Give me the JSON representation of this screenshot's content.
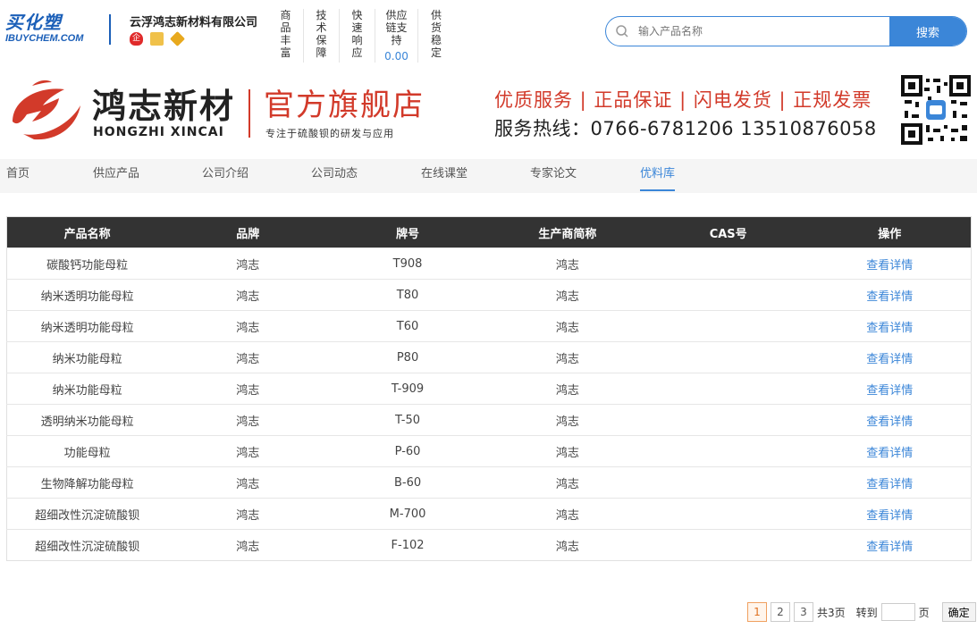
{
  "site": {
    "logo_cn": "买化塑",
    "logo_en": "IBUYCHEM.COM",
    "company": "云浮鸿志新材料有限公司",
    "features": [
      {
        "label": "商品丰富"
      },
      {
        "label": "技术保障"
      },
      {
        "label": "快速响应"
      },
      {
        "label": "供应链支持",
        "value": "0.00"
      },
      {
        "label": "供货稳定"
      }
    ],
    "search": {
      "placeholder": "输入产品名称",
      "button": "搜索"
    }
  },
  "banner": {
    "brand_cn": "鸿志新材",
    "brand_en": "HONGZHI XINCAI",
    "flagship": "官方旗舰店",
    "flagship_sub": "专注于硫酸钡的研发与应用",
    "slogan": "优质服务 | 正品保证 | 闪电发货 | 正规发票",
    "hotline": "服务热线：0766-6781206  13510876058"
  },
  "nav": {
    "items": [
      "首页",
      "供应产品",
      "公司介绍",
      "公司动态",
      "在线课堂",
      "专家论文",
      "优料库"
    ],
    "active_index": 6
  },
  "table": {
    "headers": [
      "产品名称",
      "品牌",
      "牌号",
      "生产商简称",
      "CAS号",
      "操作"
    ],
    "rows": [
      [
        "碳酸钙功能母粒",
        "鸿志",
        "T908",
        "鸿志",
        "",
        "查看详情"
      ],
      [
        "纳米透明功能母粒",
        "鸿志",
        "T80",
        "鸿志",
        "",
        "查看详情"
      ],
      [
        "纳米透明功能母粒",
        "鸿志",
        "T60",
        "鸿志",
        "",
        "查看详情"
      ],
      [
        "纳米功能母粒",
        "鸿志",
        "P80",
        "鸿志",
        "",
        "查看详情"
      ],
      [
        "纳米功能母粒",
        "鸿志",
        "T-909",
        "鸿志",
        "",
        "查看详情"
      ],
      [
        "透明纳米功能母粒",
        "鸿志",
        "T-50",
        "鸿志",
        "",
        "查看详情"
      ],
      [
        "功能母粒",
        "鸿志",
        "P-60",
        "鸿志",
        "",
        "查看详情"
      ],
      [
        "生物降解功能母粒",
        "鸿志",
        "B-60",
        "鸿志",
        "",
        "查看详情"
      ],
      [
        "超细改性沉淀硫酸钡",
        "鸿志",
        "M-700",
        "鸿志",
        "",
        "查看详情"
      ],
      [
        "超细改性沉淀硫酸钡",
        "鸿志",
        "F-102",
        "鸿志",
        "",
        "查看详情"
      ]
    ]
  },
  "pager": {
    "pages": [
      "1",
      "2",
      "3"
    ],
    "current": "1",
    "total": "共3页",
    "goto": "转到",
    "page_unit": "页",
    "confirm": "确定"
  },
  "colors": {
    "accent": "#3b86d8",
    "brand_red": "#d23a2a",
    "header_dark": "#333333"
  }
}
